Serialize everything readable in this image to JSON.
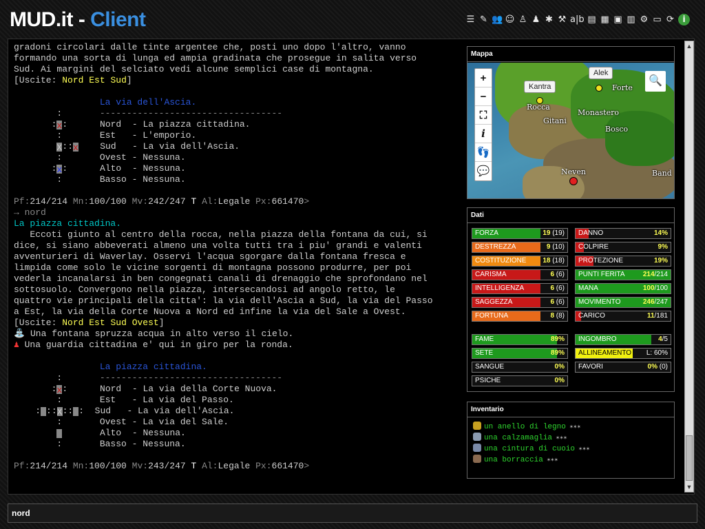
{
  "header": {
    "title_main": "MUD.it - ",
    "title_accent": "Client",
    "toolbar_icons": [
      "list-icon",
      "notes-icon",
      "group-icon",
      "people-icon",
      "person-icon",
      "person-stop-icon",
      "bug-icon",
      "tools-icon",
      "font-size-icon",
      "document-icon",
      "table-icon",
      "script-icon",
      "grid-icon",
      "settings-icon",
      "screen-icon",
      "refresh-icon",
      "info-icon"
    ]
  },
  "output": {
    "p1_l1": "gradoni circolari dalle tinte argentee che, posti uno dopo l'altro, vanno",
    "p1_l2": "formando una sorta di lunga ed ampia gradinata che prosegue in salita verso",
    "p1_l3": "Sud. Ai margini del selciato vedi alcune semplici case di montagna.",
    "exits1_prefix": "[Uscite: ",
    "exits1": [
      "Nord",
      "Est",
      "Sud"
    ],
    "exits_suffix": "]",
    "room1_title": "La via dell'Ascia.",
    "divider": "----------------------------------",
    "room1_exits": [
      "Nord  - La piazza cittadina.",
      "Est   - L'emporio.",
      "Sud   - La via dell'Ascia.",
      "Ovest - Nessuna.",
      "Alto  - Nessuna.",
      "Basso - Nessuna."
    ],
    "prompt1": {
      "pf_label": "Pf:",
      "pf": "214/214",
      "mn_label": " Mn:",
      "mn": "100/100",
      "mv_label": " Mv:",
      "mv": "242/247",
      "t": " T",
      "al_label": " Al:",
      "al": "Legale",
      "px_label": " Px:",
      "px": "661470",
      ">": ">"
    },
    "echo": "→ nord",
    "room2_name": "La piazza cittadina.",
    "p2": [
      "   Eccoti giunto al centro della rocca, nella piazza della fontana da cui, si",
      "dice, si siano abbeverati almeno una volta tutti tra i piu' grandi e valenti",
      "avventurieri di Waverlay. Osservi l'acqua sgorgare dalla fontana fresca e",
      "limpida come solo le vicine sorgenti di montagna possono produrre, per poi",
      "vederla incanalarsi in ben congegnati canali di drenaggio che sprofondano nel",
      "sottosuolo. Convergono nella piazza, intersecandosi ad angolo retto, le",
      "quattro vie principali della citta': la via dell'Ascia a Sud, la via del Passo",
      "a Est, la via della Corte Nuova a Nord ed infine la via del Sale a Ovest."
    ],
    "exits2": [
      "Nord",
      "Est",
      "Sud",
      "Ovest"
    ],
    "obj1": " Una fontana spruzza acqua in alto verso il cielo.",
    "obj2": " Una guardia cittadina e' qui in giro per la ronda.",
    "room2_title": "La piazza cittadina.",
    "room2_exits": [
      "Nord  - La via della Corte Nuova.",
      "Est   - La via del Passo.",
      "Sud   - La via dell'Ascia.",
      "Ovest - La via del Sale.",
      "Alto  - Nessuna.",
      "Basso - Nessuna."
    ],
    "prompt2": {
      "mv": "243/247"
    }
  },
  "map": {
    "title": "Mappa",
    "zoom_in": "+",
    "zoom_out": "−",
    "labels": [
      "Rocca",
      "Gitani",
      "Monastero",
      "Forte",
      "Bosco",
      "Neven",
      "Band"
    ],
    "markers": [
      {
        "name": "Kantra",
        "color": "#f0e020"
      },
      {
        "name": "Alek",
        "color": "#f0e020"
      }
    ]
  },
  "dati": {
    "title": "Dati",
    "left": [
      {
        "label": "FORZA",
        "val": "19",
        "max": " (19)",
        "pct": 0.72,
        "color": "#1e9a1e"
      },
      {
        "label": "DESTREZZA",
        "val": "9",
        "max": " (10)",
        "pct": 0.72,
        "color": "#e86a1a"
      },
      {
        "label": "COSTITUZIONE",
        "val": "18",
        "max": " (18)",
        "pct": 0.72,
        "color": "#f08a10"
      },
      {
        "label": "CARISMA",
        "val": "6",
        "max": " (6)",
        "pct": 0.72,
        "color": "#c81818"
      },
      {
        "label": "INTELLIGENZA",
        "val": "6",
        "max": " (6)",
        "pct": 0.72,
        "color": "#c81818"
      },
      {
        "label": "SAGGEZZA",
        "val": "6",
        "max": " (6)",
        "pct": 0.72,
        "color": "#c81818"
      },
      {
        "label": "FORTUNA",
        "val": "8",
        "max": " (8)",
        "pct": 0.72,
        "color": "#e86a1a"
      },
      {
        "label": "FAME",
        "val": "89%",
        "max": "",
        "pct": 0.89,
        "color": "#1e9a1e"
      },
      {
        "label": "SETE",
        "val": "89%",
        "max": "",
        "pct": 0.89,
        "color": "#1e9a1e"
      },
      {
        "label": "SANGUE",
        "val": "0%",
        "max": "",
        "pct": 0,
        "color": "#1e9a1e"
      },
      {
        "label": "PSICHE",
        "val": "0%",
        "max": "",
        "pct": 0,
        "color": "#1e9a1e"
      }
    ],
    "right": [
      {
        "label": "DANNO",
        "val": "14%",
        "max": "",
        "pct": 0.14,
        "color": "#c81818"
      },
      {
        "label": "COLPIRE",
        "val": "9%",
        "max": "",
        "pct": 0.09,
        "color": "#c81818"
      },
      {
        "label": "PROTEZIONE",
        "val": "19%",
        "max": "",
        "pct": 0.19,
        "color": "#c81818"
      },
      {
        "label": "PUNTI FERITA",
        "val": "214",
        "max": "/214",
        "pct": 1,
        "color": "#1e9a1e"
      },
      {
        "label": "MANA",
        "val": "100",
        "max": "/100",
        "pct": 1,
        "color": "#1e9a1e"
      },
      {
        "label": "MOVIMENTO",
        "val": "246",
        "max": "/247",
        "pct": 1,
        "color": "#1e9a1e"
      },
      {
        "label": "CARICO",
        "val": "11",
        "max": "/181",
        "pct": 0.06,
        "color": "#c81818"
      },
      {
        "label": "INGOMBRO",
        "val": "4",
        "max": "/5",
        "pct": 0.8,
        "color": "#1e9a1e"
      },
      {
        "label": "ALLINEAMENTO",
        "val": "",
        "max": "L: 60%",
        "pct": 0.6,
        "color": "#f0f010"
      },
      {
        "label": "FAVORI",
        "val": "0%",
        "max": " (0)",
        "pct": 0,
        "color": "#1e9a1e"
      }
    ]
  },
  "inventory": {
    "title": "Inventario",
    "items": [
      {
        "name": "un anello di legno",
        "stars": " ✶✶✶",
        "color": "#c8a020"
      },
      {
        "name": "una calzamaglia",
        "stars": " ✶✶✶",
        "color": "#8a9ab0"
      },
      {
        "name": "una cintura di cuoio",
        "stars": " ✶✶✶",
        "color": "#7a8aa8"
      },
      {
        "name": "una borraccia",
        "stars": " ✶✶✶",
        "color": "#8a6a50"
      }
    ]
  },
  "command": {
    "value": "nord"
  }
}
